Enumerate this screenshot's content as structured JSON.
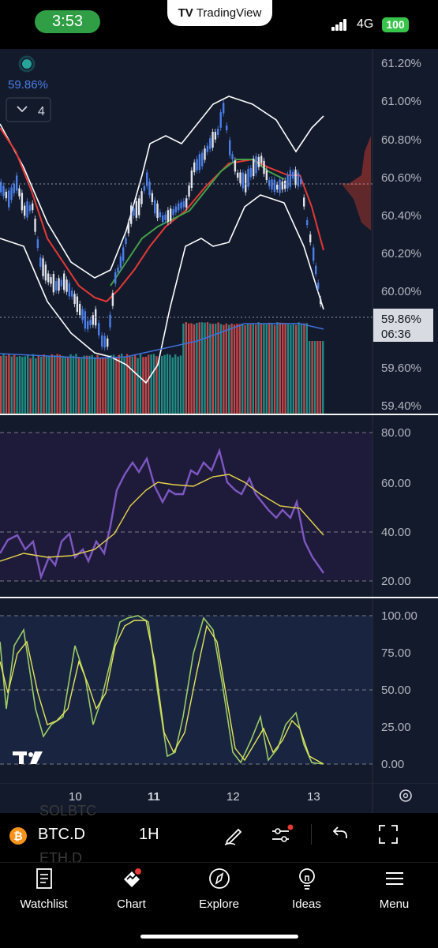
{
  "status_bar": {
    "time": "3:53",
    "carrier_app": "TradingView",
    "network": "4G",
    "battery": "100"
  },
  "chart": {
    "last_value_left": "59.86%",
    "indicator_count": "4",
    "price_axis": [
      "61.20%",
      "61.00%",
      "60.80%",
      "60.60%",
      "60.40%",
      "60.20%",
      "60.00%",
      "59.60%",
      "59.40%"
    ],
    "current_price": "59.86%",
    "countdown": "06:36",
    "rsi_axis": [
      "80.00",
      "60.00",
      "40.00",
      "20.00"
    ],
    "stoch_axis": [
      "100.00",
      "75.00",
      "50.00",
      "25.00",
      "0.00"
    ],
    "time_axis": [
      "10",
      "11",
      "12",
      "13"
    ]
  },
  "toolbar": {
    "symbol": "BTC.D",
    "symbol_icon": "bitcoin-icon",
    "timeframe": "1H",
    "behind_top": "SOLBTC",
    "behind_bottom": "ETH.D"
  },
  "nav": [
    {
      "label": "Watchlist",
      "icon": "watchlist-icon"
    },
    {
      "label": "Chart",
      "icon": "chart-icon"
    },
    {
      "label": "Explore",
      "icon": "compass-icon"
    },
    {
      "label": "Ideas",
      "icon": "bulb-icon"
    },
    {
      "label": "Menu",
      "icon": "menu-icon"
    }
  ],
  "colors": {
    "rsi": "#7e57c2",
    "rsi_ma": "#e6d34a",
    "stoch_k": "#9ccc65",
    "stoch_d": "#e6e45a",
    "ema_fast": "#e53935",
    "ema_slow": "#43a047",
    "bollinger": "#ffffff"
  }
}
